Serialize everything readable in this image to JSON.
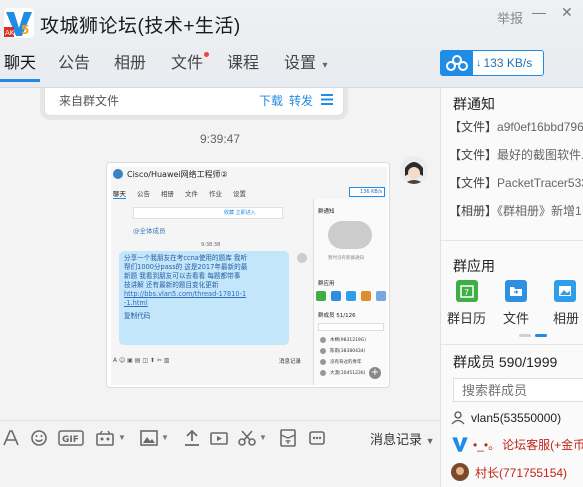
{
  "header": {
    "title": "攻城狮论坛(技术+生活)",
    "report_label": "举报",
    "tabs": [
      {
        "label": "聊天",
        "active": true
      },
      {
        "label": "公告"
      },
      {
        "label": "相册"
      },
      {
        "label": "文件",
        "has_dot": true
      },
      {
        "label": "课程"
      },
      {
        "label": "设置"
      }
    ],
    "speed": "133 KB/s"
  },
  "chat": {
    "file_source": "来自群文件",
    "download_label": "下载",
    "forward_label": "转发",
    "timestamp": "9:39:47"
  },
  "screenshot": {
    "title": "Cisco/Huawei网络工程师②",
    "tabs": [
      "聊天",
      "公告",
      "相册",
      "文件",
      "作业",
      "设置"
    ],
    "speed": "136 KB/s",
    "bar_actions": "收藏  立即进入",
    "at_all": "@全体成员",
    "time": "9:38:38",
    "message_lines": [
      "分享一个我朋友在考ccna使用的题库 我听",
      "帮们1000分pass的 这是2017年最新的最",
      "新题 我看到朋友可以去看看 每题都带事",
      "技讲解 还有最新的题目变化更新"
    ],
    "link_lines": [
      "http://bbs.vlan5.com/thread-17810-1",
      "-1.html"
    ],
    "copy_label": "复制代码",
    "history": "消息记录",
    "side_notice": "群通知",
    "side_note": "暂时没有新群通知",
    "side_apps": "群应用",
    "side_members": "群成员 51/126",
    "members": [
      "木棉(9831219G)",
      "陈雨(38380434)",
      "没有背过的青年",
      "大漠(10451236)"
    ]
  },
  "toolbar": {
    "history_label": "消息记录"
  },
  "sidebar": {
    "notice_title": "群通知",
    "notices": [
      {
        "tag": "【文件】",
        "text": "a9f0ef16bbd79699"
      },
      {
        "tag": "【文件】",
        "text": "最好的截图软件.e"
      },
      {
        "tag": "【文件】",
        "text": "PacketTracer533_s"
      },
      {
        "tag": "【相册】",
        "text": "《群相册》新增1张"
      }
    ],
    "apps_title": "群应用",
    "apps": [
      {
        "label": "群日历",
        "color": "#3fae46"
      },
      {
        "label": "文件",
        "color": "#2f8fe0"
      },
      {
        "label": "相册",
        "color": "#2f9ee8"
      }
    ],
    "members_title": "群成员 590/1999",
    "search_placeholder": "搜索群成员",
    "members": [
      {
        "name": "vlan5(53550000)",
        "color": "#222"
      },
      {
        "name": "论坛客服(+金币",
        "prefix": "•_•。",
        "color": "#c0271a"
      },
      {
        "name": "村长(771755154)",
        "color": "#c0271a"
      }
    ]
  }
}
